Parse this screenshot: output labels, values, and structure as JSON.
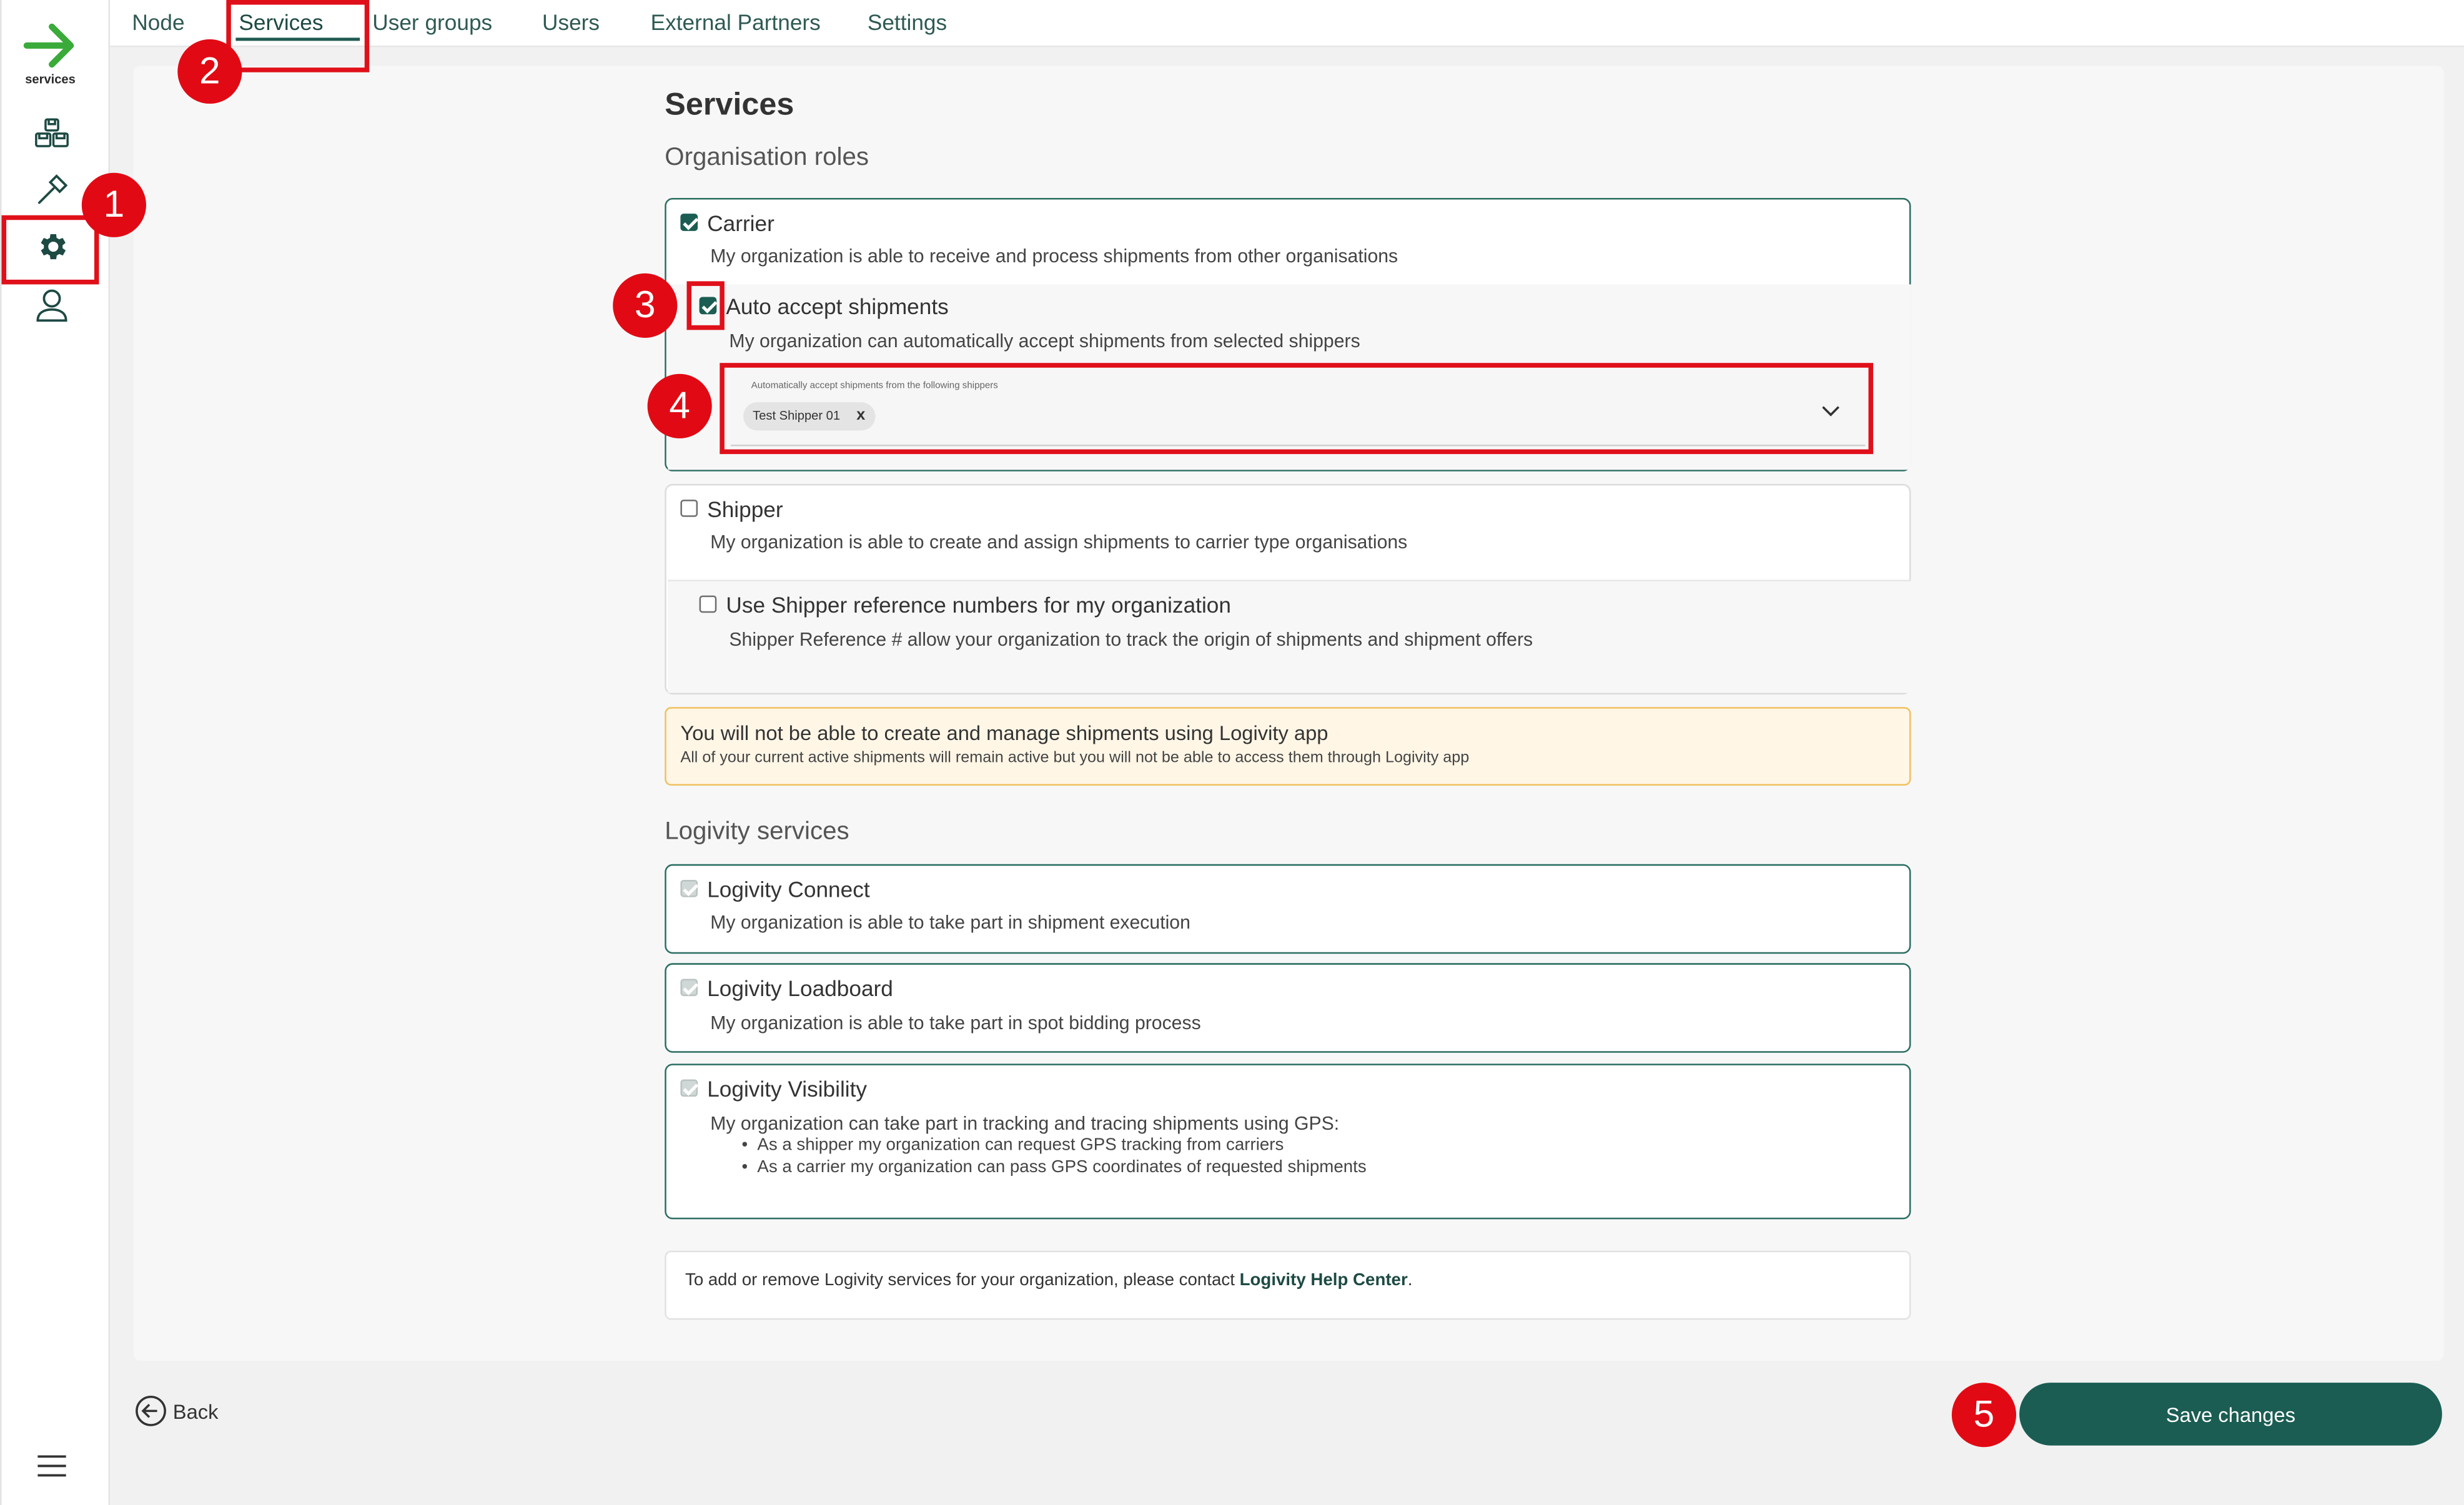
{
  "sidebar": {
    "logo_text": "services",
    "icons": [
      "pallets-icon",
      "hammer-icon",
      "gear-icon",
      "user-icon",
      "hamburger-icon"
    ],
    "accent": "#1b5d52"
  },
  "tabs": [
    {
      "label": "Node"
    },
    {
      "label": "Services"
    },
    {
      "label": "User groups"
    },
    {
      "label": "Users"
    },
    {
      "label": "External Partners"
    },
    {
      "label": "Settings"
    }
  ],
  "page": {
    "title": "Services",
    "org_roles_heading": "Organisation roles",
    "services_heading": "Logivity services"
  },
  "carrier": {
    "title": "Carrier",
    "desc": "My organization is able to receive and process shipments from other organisations",
    "checked": true,
    "auto_accept": {
      "title": "Auto accept shipments",
      "desc": "My organization can automatically accept shipments from selected shippers",
      "checked": true,
      "select_label": "Automatically accept shipments from the following shippers",
      "chips": [
        "Test Shipper 01"
      ],
      "chip_remove": "x"
    }
  },
  "shipper": {
    "title": "Shipper",
    "desc": "My organization is able to create and assign shipments to carrier type organisations",
    "checked": false,
    "ref": {
      "title": "Use Shipper reference numbers for my organization",
      "desc": "Shipper Reference # allow your organization to track the origin of shipments and shipment offers",
      "checked": false
    }
  },
  "warning": {
    "title": "You will not be able to create and manage shipments using Logivity app",
    "desc": "All of your current active shipments will remain active but you will not be able to access them through Logivity app"
  },
  "services": [
    {
      "title": "Logivity Connect",
      "desc": "My organization is able to take part in shipment execution"
    },
    {
      "title": "Logivity Loadboard",
      "desc": "My organization is able to take part in spot bidding process"
    },
    {
      "title": "Logivity Visibility",
      "desc": "My organization can take part in tracking and tracing shipments using GPS:",
      "bullets": [
        "As a shipper my organization can request GPS tracking from carriers",
        "As a carrier my organization can pass GPS coordinates of requested shipments"
      ]
    }
  ],
  "info": {
    "text": "To add or remove Logivity services for your organization, please contact ",
    "link": "Logivity Help Center",
    "suffix": "."
  },
  "footer": {
    "back": "Back",
    "save": "Save changes"
  },
  "annotations": [
    "1",
    "2",
    "3",
    "4",
    "5"
  ]
}
